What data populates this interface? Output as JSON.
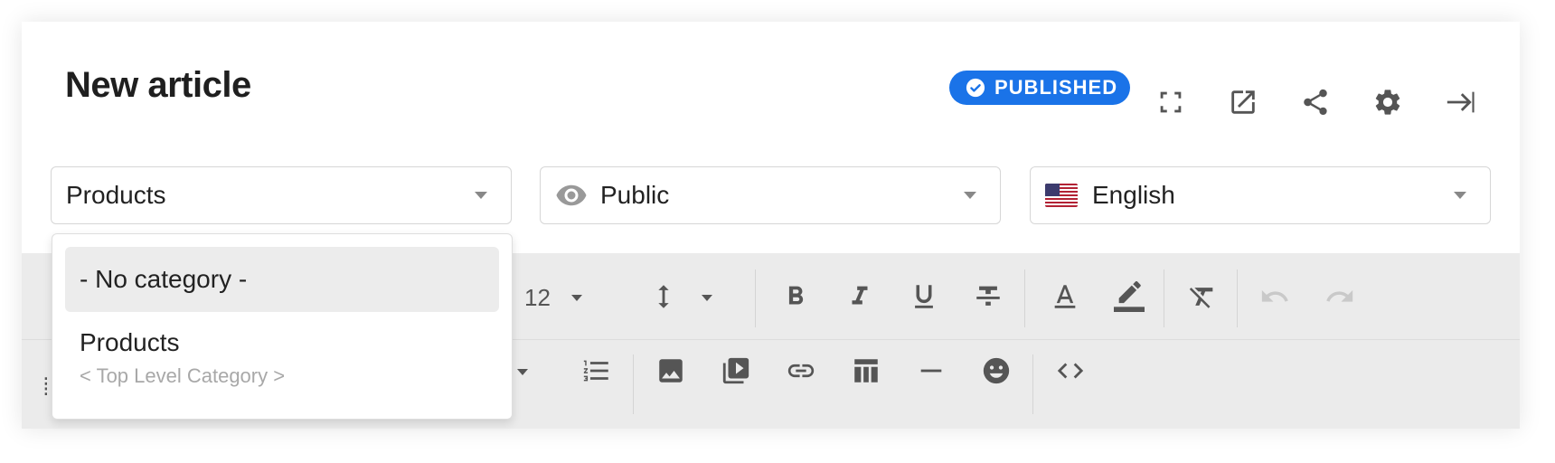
{
  "header": {
    "title": "New article",
    "status_badge": "PUBLISHED",
    "accent_color": "#1a73e8",
    "icons": [
      "fullscreen-icon",
      "open-external-icon",
      "share-icon",
      "settings-icon",
      "collapse-panel-icon"
    ]
  },
  "selectors": {
    "category": {
      "value": "Products"
    },
    "visibility": {
      "value": "Public",
      "icon": "eye-icon"
    },
    "language": {
      "value": "English",
      "icon": "us-flag-icon"
    }
  },
  "toolbar": {
    "font_size": "12",
    "row1_icons": [
      "line-height-icon",
      "bold-icon",
      "italic-icon",
      "underline-icon",
      "strikethrough-icon",
      "text-color-icon",
      "highlight-icon",
      "clear-format-icon",
      "undo-icon",
      "redo-icon"
    ],
    "row2_icons": [
      "ordered-list-icon",
      "image-icon",
      "video-icon",
      "link-icon",
      "table-icon",
      "horizontal-rule-icon",
      "emoji-icon",
      "code-icon"
    ]
  },
  "category_dropdown": {
    "options": [
      {
        "label": "- No category -",
        "selected": true
      },
      {
        "label": "Products",
        "sublabel": "< Top Level Category >"
      }
    ]
  }
}
